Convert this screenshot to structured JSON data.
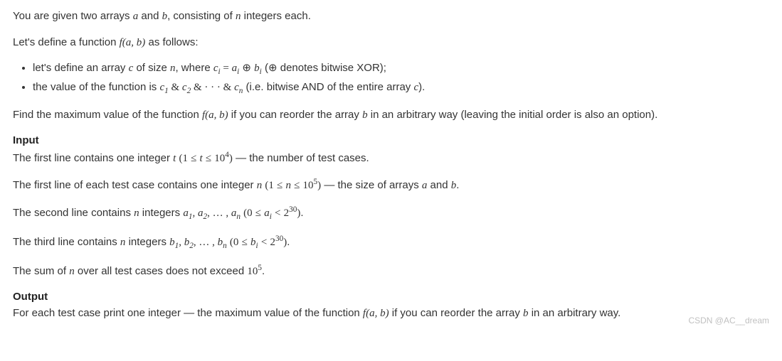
{
  "intro": {
    "p1_a": "You are given two arrays ",
    "p1_b": " and ",
    "p1_c": ", consisting of ",
    "p1_d": " integers each.",
    "p2_a": "Let's define a function ",
    "p2_b": " as follows:"
  },
  "math": {
    "a": "a",
    "b": "b",
    "n": "n",
    "c": "c",
    "t": "t",
    "fab": "f(a, b)",
    "ci": "c",
    "ai": "a",
    "bi": "b",
    "sub_i": "i",
    "sub_1": "1",
    "sub_2": "2",
    "sub_n": "n",
    "xor": "⊕",
    "and": "&",
    "dots": "· · ·",
    "lparen": "(",
    "rparen": ")",
    "le": "≤",
    "lt": "<",
    "one": "1",
    "zero": "0",
    "two": "2",
    "ten": "10",
    "exp4": "4",
    "exp5": "5",
    "exp30": "30",
    "comma": ", ",
    "ldots": ", … ,"
  },
  "bullets": {
    "b1_a": "let's define an array ",
    "b1_b": " of size ",
    "b1_c": ", where ",
    "b1_d": " = ",
    "b1_e": " (",
    "b1_f": " denotes bitwise XOR);",
    "b2_a": "the value of the function is ",
    "b2_b": " (i.e. bitwise AND of the entire array ",
    "b2_c": ")."
  },
  "task": {
    "a": "Find the maximum value of the function ",
    "b": " if you can reorder the array ",
    "c": " in an arbitrary way (leaving the initial order is also an option)."
  },
  "input": {
    "head": "Input",
    "l1_a": "The first line contains one integer ",
    "l1_b": " — the number of test cases.",
    "l2_a": "The first line of each test case contains one integer ",
    "l2_b": " — the size of arrays ",
    "l2_c": " and ",
    "l2_d": ".",
    "l3_a": "The second line contains ",
    "l3_b": " integers ",
    "l3_c": ".",
    "l4_a": "The third line contains ",
    "l4_b": " integers ",
    "l4_c": ".",
    "l5_a": "The sum of ",
    "l5_b": " over all test cases does not exceed ",
    "l5_c": "."
  },
  "output": {
    "head": "Output",
    "l1_a": "For each test case print one integer — the maximum value of the function ",
    "l1_b": " if you can reorder the array ",
    "l1_c": " in an arbitrary way."
  },
  "watermark": "CSDN @AC__dream"
}
